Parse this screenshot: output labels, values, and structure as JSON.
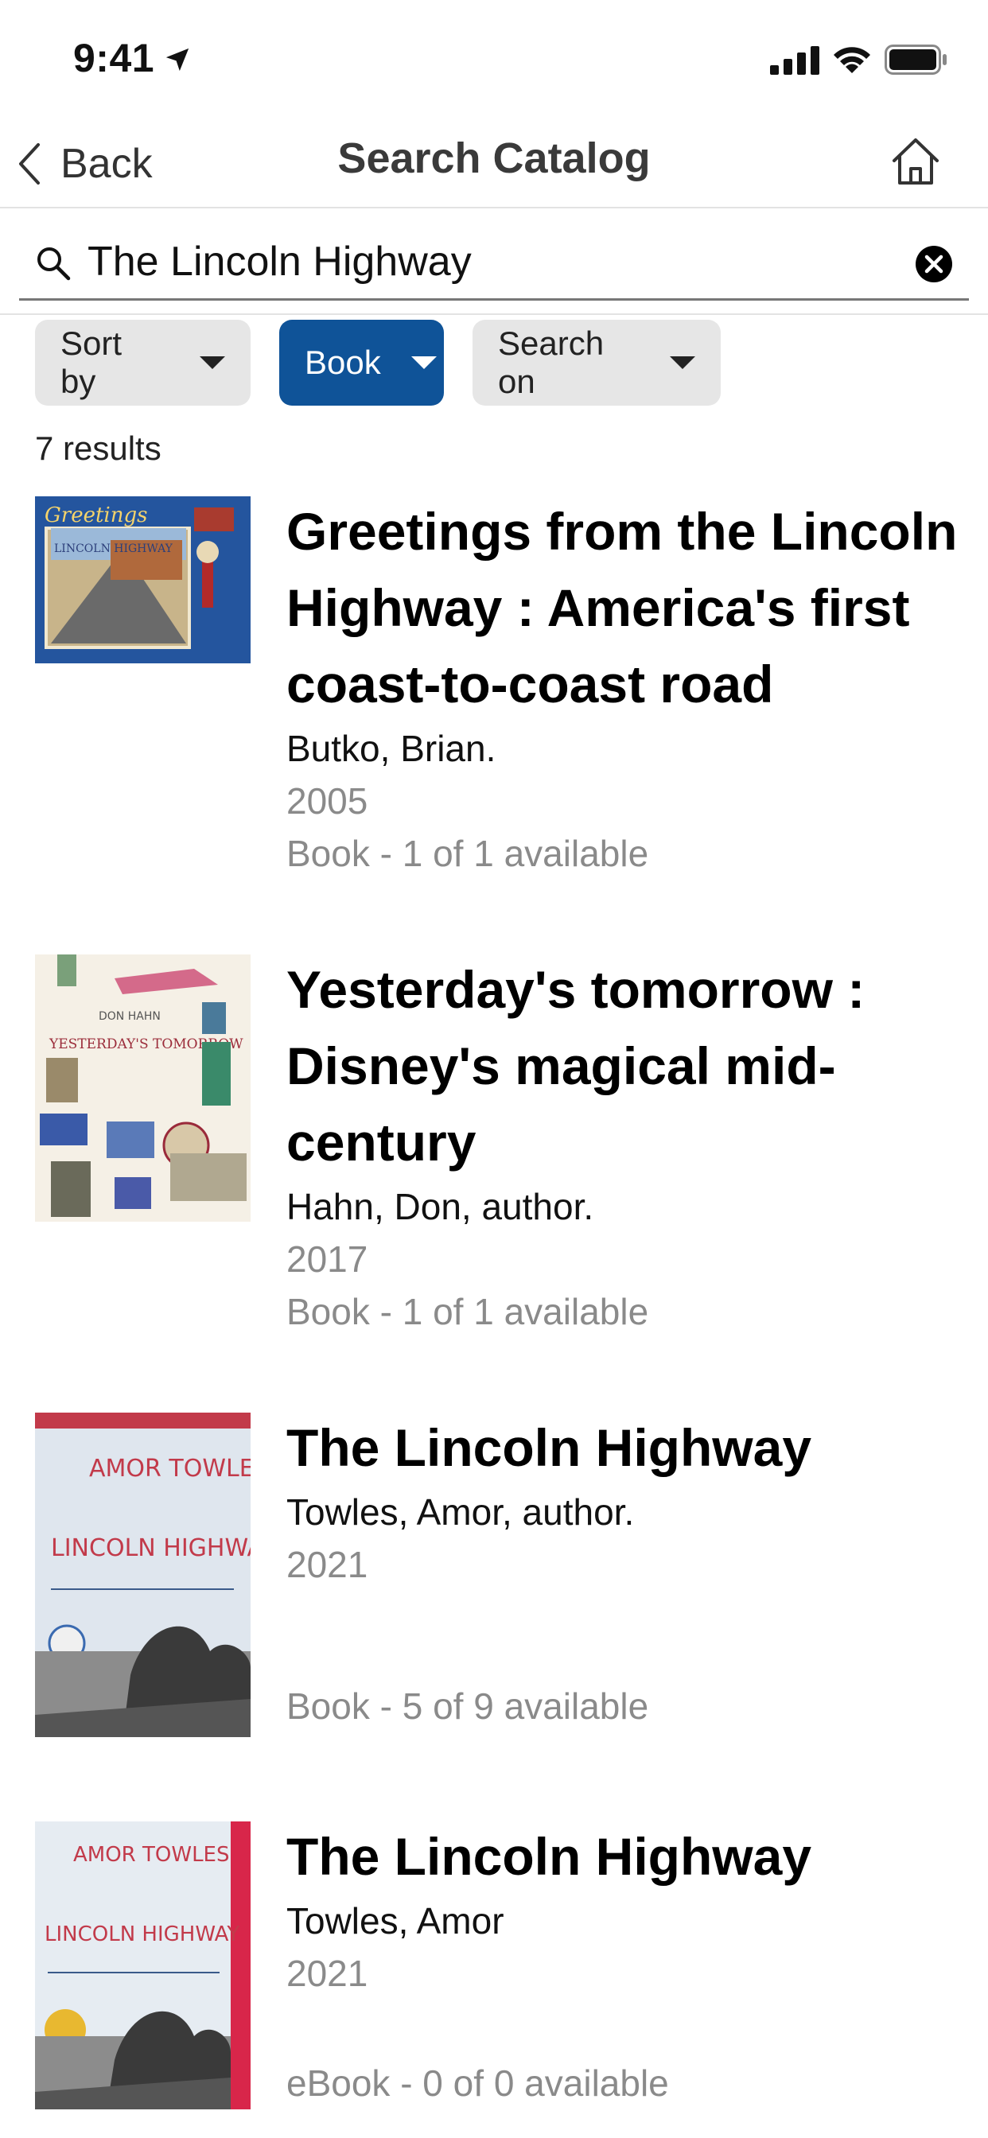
{
  "status_bar": {
    "time": "9:41"
  },
  "nav": {
    "back_label": "Back",
    "title": "Search Catalog"
  },
  "search": {
    "value": "The Lincoln Highway"
  },
  "filters": {
    "sort_label": "Sort by",
    "format_label": "Book",
    "search_on_label": "Search on"
  },
  "results_count": "7 results",
  "results": [
    {
      "title": "Greetings from the Lincoln Highway : America's first coast-to-coast road",
      "author": "Butko, Brian.",
      "year": "2005",
      "availability": "Book - 1 of 1 available",
      "cover_text": "Greetings",
      "cover_subtext": "LINCOLN HIGHWAY"
    },
    {
      "title": "Yesterday's tomorrow : Disney's magical mid-century",
      "author": "Hahn, Don, author.",
      "year": "2017",
      "availability": "Book - 1 of 1 available",
      "cover_text": "DON HAHN",
      "cover_subtext": "YESTERDAY'S TOMORROW"
    },
    {
      "title": "The Lincoln Highway",
      "author": "Towles, Amor, author.",
      "year": "2021",
      "availability": "Book - 5 of 9 available",
      "cover_text": "AMOR TOWLES",
      "cover_subtext": "LINCOLN HIGHWAY"
    },
    {
      "title": "The Lincoln Highway",
      "author": "Towles, Amor",
      "year": "2021",
      "availability": "eBook - 0 of 0 available",
      "cover_text": "AMOR TOWLES",
      "cover_subtext": "LINCOLN HIGHWAY"
    }
  ]
}
